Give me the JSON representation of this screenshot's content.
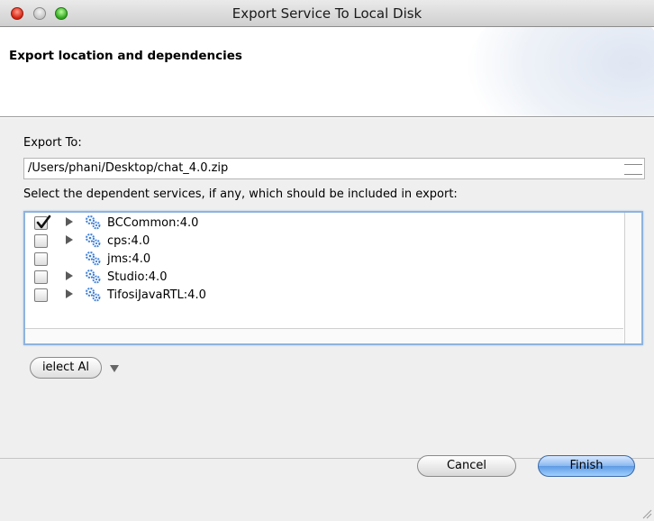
{
  "window": {
    "title": "Export Service To Local Disk"
  },
  "header": {
    "title": "Export location and dependencies"
  },
  "export_to": {
    "label": "Export To:",
    "value": "/Users/phani/Desktop/chat_4.0.zip"
  },
  "dependencies": {
    "label": "Select the dependent services, if any, which should be included in export:",
    "items": [
      {
        "label": "BCCommon:4.0",
        "checked": true,
        "expandable": true
      },
      {
        "label": "cps:4.0",
        "checked": false,
        "expandable": true
      },
      {
        "label": "jms:4.0",
        "checked": false,
        "expandable": false
      },
      {
        "label": "Studio:4.0",
        "checked": false,
        "expandable": true
      },
      {
        "label": "TifosiJavaRTL:4.0",
        "checked": false,
        "expandable": true
      }
    ]
  },
  "actions": {
    "select_all_label": "ielect Al",
    "cancel_label": "Cancel",
    "finish_label": "Finish"
  },
  "icons": {
    "node_icon": "gears-icon",
    "expander_icon": "triangle-right-icon"
  },
  "colors": {
    "focus_ring": "#8fb3de",
    "default_button": "#6fa6ea",
    "gear_blue": "#3d7fd6"
  }
}
